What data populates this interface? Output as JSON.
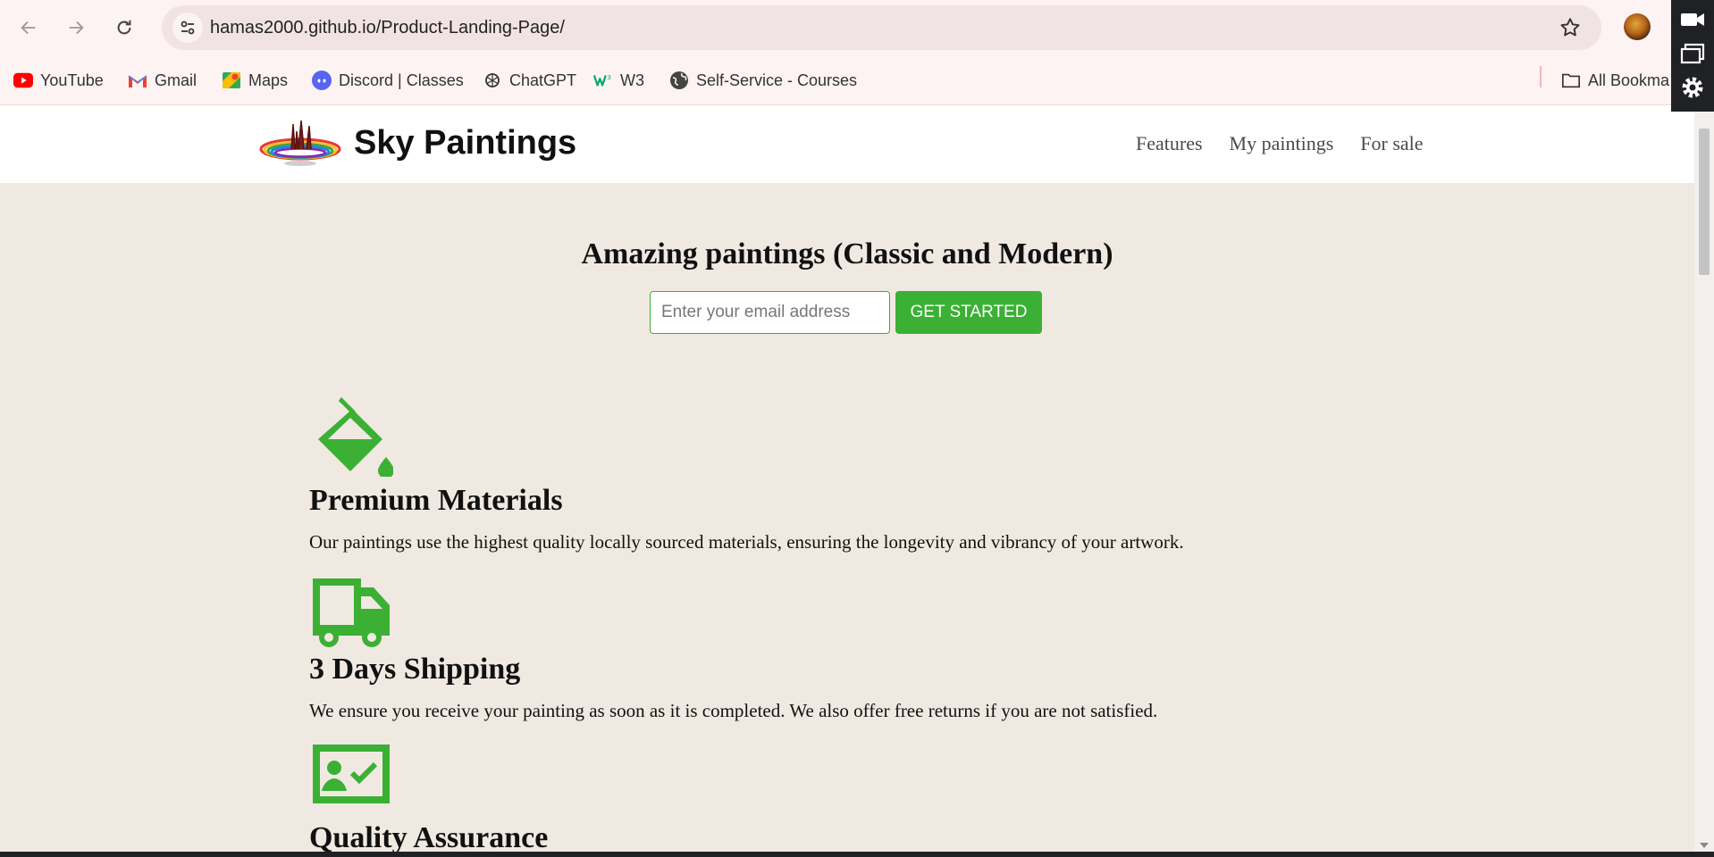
{
  "browser": {
    "url": "hamas2000.github.io/Product-Landing-Page/",
    "bookmarks": [
      {
        "label": "YouTube",
        "icon": "youtube-icon"
      },
      {
        "label": "Gmail",
        "icon": "gmail-icon"
      },
      {
        "label": "Maps",
        "icon": "maps-icon"
      },
      {
        "label": "Discord | Classes",
        "icon": "discord-icon"
      },
      {
        "label": "ChatGPT",
        "icon": "chatgpt-icon"
      },
      {
        "label": "W3",
        "icon": "w3-icon"
      },
      {
        "label": "Self-Service - Courses",
        "icon": "globe-icon"
      },
      {
        "label": "All Bookma",
        "icon": "folder-icon"
      }
    ]
  },
  "header": {
    "brand": "Sky Paintings",
    "nav": [
      "Features",
      "My paintings",
      "For sale"
    ]
  },
  "hero": {
    "title": "Amazing paintings (Classic and Modern)",
    "email_placeholder": "Enter your email address",
    "cta_label": "GET STARTED"
  },
  "features": [
    {
      "title": "Premium Materials",
      "description": "Our paintings use the highest quality locally sourced materials, ensuring the longevity and vibrancy of your artwork.",
      "icon": "paint-bucket-icon"
    },
    {
      "title": "3 Days Shipping",
      "description": "We ensure you receive your painting as soon as it is completed. We also offer free returns if you are not satisfied.",
      "icon": "truck-icon"
    },
    {
      "title": "Quality Assurance",
      "description": "",
      "icon": "id-card-check-icon"
    }
  ],
  "colors": {
    "accent": "#3cb034",
    "page_bg": "#f0e9e2",
    "header_bg": "#ffffff",
    "chrome_bg": "#fdf3f3"
  }
}
